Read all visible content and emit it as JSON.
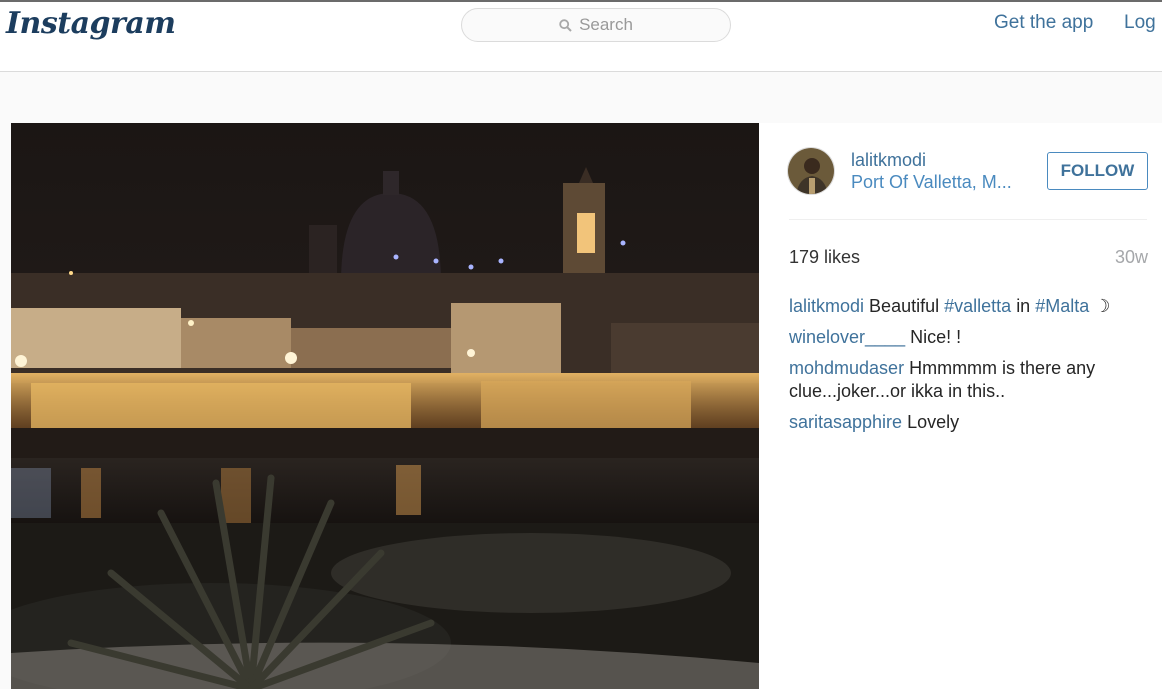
{
  "header": {
    "logo": "Instagram",
    "search_placeholder": "Search",
    "get_app": "Get the app",
    "login": "Log"
  },
  "post": {
    "username": "lalitkmodi",
    "location": "Port Of Valletta, M...",
    "follow_label": "FOLLOW",
    "likes": "179 likes",
    "age": "30w",
    "caption": {
      "user": "lalitkmodi",
      "text_1": "Beautiful",
      "tag_1": "#valletta",
      "text_2": "in",
      "tag_2": "#Malta",
      "emoji": "☽"
    },
    "comments": [
      {
        "user": "winelover____",
        "text": "Nice! !"
      },
      {
        "user": "mohdmudaser",
        "text": "Hmmmmm is there any clue...joker...or ikka in this.."
      },
      {
        "user": "saritasapphire",
        "text": "Lovely"
      }
    ]
  },
  "colors": {
    "link": "#3f729b",
    "background": "#fafafa"
  }
}
